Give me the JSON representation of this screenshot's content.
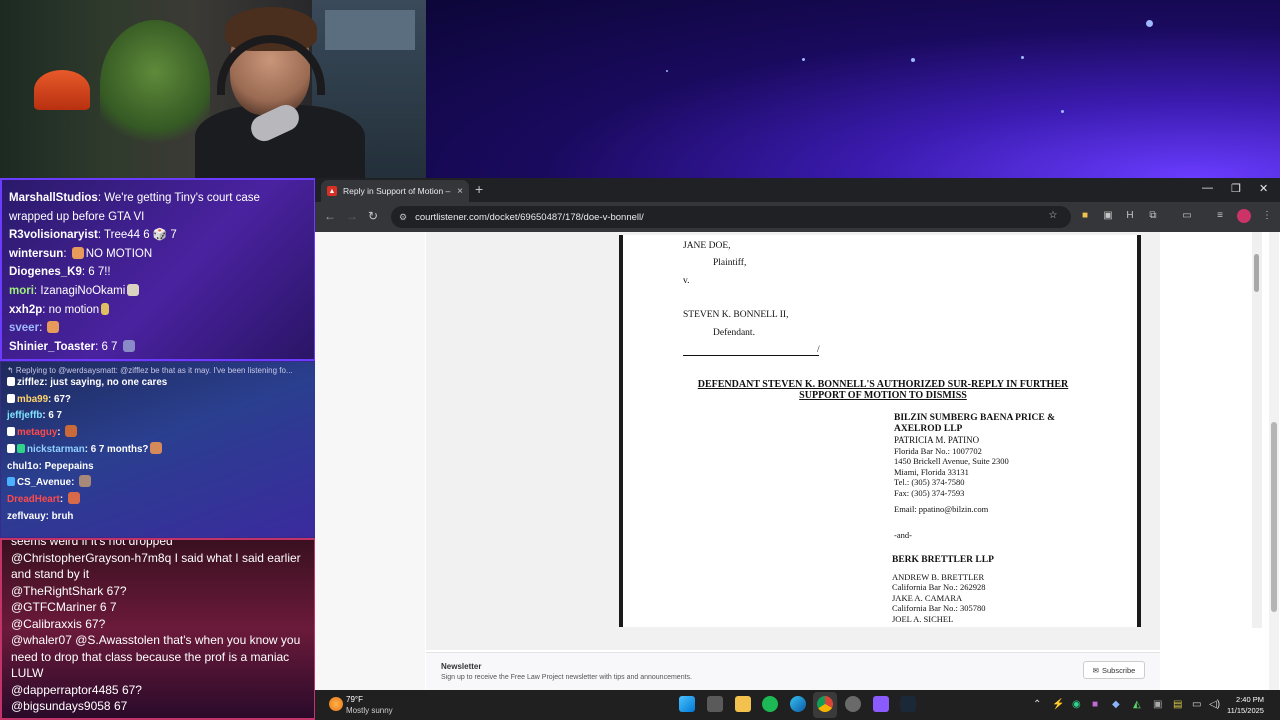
{
  "chat_top": {
    "messages": [
      {
        "user": "MarshallStudios",
        "text": "We're getting Tiny's court case wrapped up before GTA VI",
        "color": "#ffffff"
      },
      {
        "user": "R3volisionaryist",
        "text": "Tree44 6 🎲 7",
        "color": "#ffffff"
      },
      {
        "user": "wintersun",
        "text": "NO MOTION",
        "color": "#ffffff"
      },
      {
        "user": "Diogenes_K9",
        "text": "6 7!!",
        "color": "#ffffff"
      },
      {
        "user": "mori",
        "text": "IzanagiNoOkami",
        "color": "#9ef07a"
      },
      {
        "user": "xxh2p",
        "text": "no motion",
        "color": "#ffffff"
      },
      {
        "user": "sveer",
        "text": "",
        "color": "#9fb8ff"
      },
      {
        "user": "Shinier_Toaster",
        "text": "6 7",
        "color": "#ffffff"
      }
    ]
  },
  "chat_mid": {
    "reply_line": "↰ Replying to @werdsaysmatt: @zifflez be that as it may. I've been listening fo...",
    "messages": [
      {
        "user": "zifflez",
        "text": "just saying, no one cares",
        "color": "#ffffff"
      },
      {
        "user": "mba99",
        "text": "67?",
        "color": "#ffd36b"
      },
      {
        "user": "jeffjeffb",
        "text": "6 7",
        "color": "#7fe3ff"
      },
      {
        "user": "metaguy",
        "text": "",
        "color": "#ff4a4a"
      },
      {
        "user": "nickstarman",
        "text": "6 7 months?",
        "color": "#8fd0ff"
      },
      {
        "user": "chul1o",
        "text": "Pepepains",
        "color": "#ffffff"
      },
      {
        "user": "CS_Avenue",
        "text": "",
        "color": "#ffffff"
      },
      {
        "user": "DreadHeart",
        "text": "",
        "color": "#ff4a4a"
      },
      {
        "user": "zeflvauy",
        "text": "bruh",
        "color": "#ffffff"
      }
    ]
  },
  "chat_bot": {
    "partial": "seems weird if it's not dropped",
    "messages": [
      {
        "user": "@ChristopherGrayson-h7m8q",
        "text": "I said what I said earlier and stand by it"
      },
      {
        "user": "@TheRightShark",
        "text": "67?"
      },
      {
        "user": "@GTFCMariner",
        "text": "6 7"
      },
      {
        "user": "@Calibraxxis",
        "text": "67?"
      },
      {
        "user": "@whaler07",
        "text": "@S.Awasstolen that's when you know you need to drop that class because the prof is a maniac LULW"
      },
      {
        "user": "@dapperraptor4485",
        "text": "67?"
      },
      {
        "user": "@bigsundays9058",
        "text": "67"
      }
    ]
  },
  "browser": {
    "tab_title": "Reply in Support of Motion – #",
    "url": "courtlistener.com/docket/69650487/178/doe-v-bonnell/",
    "new_tab": "+",
    "tab_close": "×",
    "minimize": "—",
    "maximize": "❐",
    "close": "✕"
  },
  "document": {
    "plaintiff_name": "JANE DOE,",
    "plaintiff_label": "Plaintiff,",
    "versus": "v.",
    "defendant_name": "STEVEN K. BONNELL II,",
    "defendant_label": "Defendant.",
    "line_end": "/",
    "title": "DEFENDANT STEVEN K. BONNELL'S AUTHORIZED SUR-REPLY IN FURTHER SUPPORT OF MOTION TO DISMISS",
    "firm1_name_line1": "BILZIN SUMBERG BAENA PRICE &",
    "firm1_name_line2": "AXELROD LLP",
    "firm1_lines": [
      "PATRICIA M. PATINO",
      "Florida Bar No.: 1007702",
      "1450 Brickell Avenue, Suite 2300",
      "Miami, Florida 33131",
      "Tel.: (305) 374-7580",
      "Fax: (305) 374-7593"
    ],
    "email": "Email: ppatino@bilzin.com",
    "and": "-and-",
    "firm2_name": "BERK BRETTLER LLP",
    "firm2_lines": [
      "ANDREW B. BRETTLER",
      "California Bar No.: 262928",
      "JAKE A. CAMARA",
      "California Bar No.: 305780",
      "JOEL A. SICHEL"
    ]
  },
  "newsletter": {
    "title": "Newsletter",
    "text": "Sign up to receive the Free Law Project newsletter with tips and announcements.",
    "button": "Subscribe"
  },
  "taskbar": {
    "temperature": "79°F",
    "condition": "Mostly sunny",
    "time": "2:40 PM",
    "date": "11/15/2025"
  }
}
